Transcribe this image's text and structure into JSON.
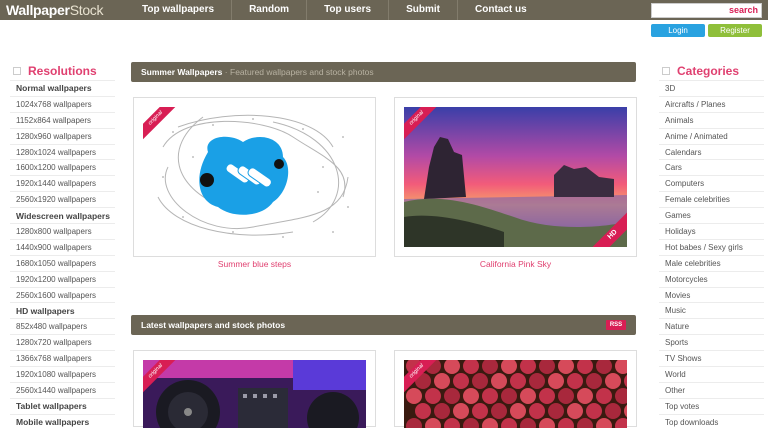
{
  "header": {
    "logo_main": "Wallpaper",
    "logo_sub": "Stock",
    "nav": [
      "Top wallpapers",
      "Random",
      "Top users",
      "Submit",
      "Contact us"
    ],
    "search_placeholder": "",
    "search_button": "search",
    "login": "Login",
    "register": "Register"
  },
  "left_sidebar": {
    "title": "Resolutions",
    "items": [
      {
        "label": "Normal wallpapers",
        "heading": true
      },
      {
        "label": "1024x768 wallpapers"
      },
      {
        "label": "1152x864 wallpapers"
      },
      {
        "label": "1280x960 wallpapers"
      },
      {
        "label": "1280x1024 wallpapers"
      },
      {
        "label": "1600x1200 wallpapers"
      },
      {
        "label": "1920x1440 wallpapers"
      },
      {
        "label": "2560x1920 wallpapers"
      },
      {
        "label": "Widescreen wallpapers",
        "heading": true
      },
      {
        "label": "1280x800 wallpapers"
      },
      {
        "label": "1440x900 wallpapers"
      },
      {
        "label": "1680x1050 wallpapers"
      },
      {
        "label": "1920x1200 wallpapers"
      },
      {
        "label": "2560x1600 wallpapers"
      },
      {
        "label": "HD wallpapers",
        "heading": true
      },
      {
        "label": "852x480 wallpapers"
      },
      {
        "label": "1280x720 wallpapers"
      },
      {
        "label": "1366x768 wallpapers"
      },
      {
        "label": "1920x1080 wallpapers"
      },
      {
        "label": "2560x1440 wallpapers"
      },
      {
        "label": "Tablet wallpapers",
        "heading": true
      },
      {
        "label": "Mobile wallpapers",
        "heading": true
      }
    ]
  },
  "right_sidebar": {
    "title": "Categories",
    "items": [
      "3D",
      "Aircrafts / Planes",
      "Animals",
      "Anime / Animated",
      "Calendars",
      "Cars",
      "Computers",
      "Female celebrities",
      "Games",
      "Holidays",
      "Hot babes / Sexy girls",
      "Male celebrities",
      "Motorcycles",
      "Movies",
      "Music",
      "Nature",
      "Sports",
      "TV Shows",
      "World",
      "Other",
      "Top votes",
      "Top downloads"
    ]
  },
  "featured": {
    "title": "Summer Wallpapers",
    "separator": "·",
    "subtitle": "Featured wallpapers and stock photos",
    "cards": [
      {
        "caption": "Summer blue steps",
        "badge": "original"
      },
      {
        "caption": "California Pink Sky",
        "badge": "original",
        "hd": "HD"
      }
    ]
  },
  "latest": {
    "title": "Latest wallpapers and stock photos",
    "rss": "RSS",
    "cards": [
      {
        "badge": "original"
      },
      {
        "badge": "original"
      }
    ]
  },
  "colors": {
    "bar": "#6b6555",
    "accent": "#d81e54",
    "link": "#e04070",
    "login": "#29a2e0",
    "register": "#8fbf3a"
  }
}
